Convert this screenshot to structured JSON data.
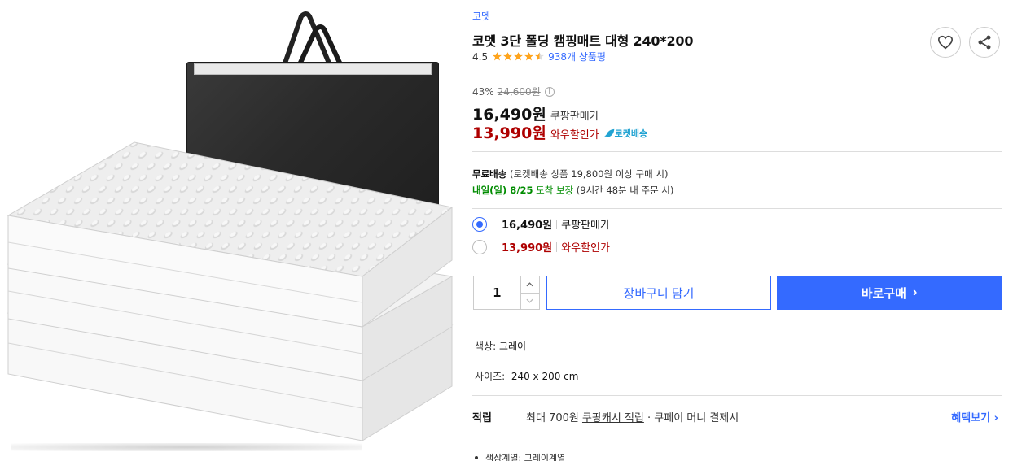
{
  "product": {
    "brand": "코멧",
    "title": "코멧 3단 폴딩 캠핑매트 대형 240*200",
    "rating": "4.5",
    "review_count": "938개 상품평"
  },
  "icons": {
    "wishlist": "heart-icon",
    "share": "share-icon",
    "info": "info-icon",
    "rocket": "rocket-icon"
  },
  "price": {
    "discount_rate": "43%",
    "original_price": "24,600원",
    "coupang_price": "16,490원",
    "coupang_label": "쿠팡판매가",
    "wow_price": "13,990원",
    "wow_label": "와우할인가",
    "rocket_label": "로켓배송"
  },
  "shipping": {
    "free_label": "무료배송",
    "free_condition": " (로켓배송 상품 19,800원 이상 구매 시)",
    "arrival": "내일(일) 8/25",
    "arrival_suffix": " 도착 보장",
    "cutoff": " (9시간 48분 내 주문 시)"
  },
  "options": [
    {
      "price": "16,490원",
      "label": "쿠팡판매가",
      "selected": true
    },
    {
      "price": "13,990원",
      "label": "와우할인가",
      "selected": false
    }
  ],
  "purchase": {
    "quantity": "1",
    "cart_label": "장바구니 담기",
    "buy_label": "바로구매",
    "buy_chevron": "›"
  },
  "attributes": {
    "color_label": "색상:",
    "color_value": "그레이",
    "size_label": "사이즈:",
    "size_value": "240 x 200 cm"
  },
  "points": {
    "title": "적립",
    "desc_prefix": "최대 700원 ",
    "desc_link": "쿠팡캐시 적립",
    "desc_suffix": " · 쿠페이 머니 결제시",
    "more": "혜택보기 ›"
  },
  "details": {
    "color_series": "색상계열: 그레이계열"
  },
  "colors": {
    "accent": "#346aff",
    "wow_red": "#ae0000",
    "star": "#ffa41c",
    "green": "#008c00"
  }
}
